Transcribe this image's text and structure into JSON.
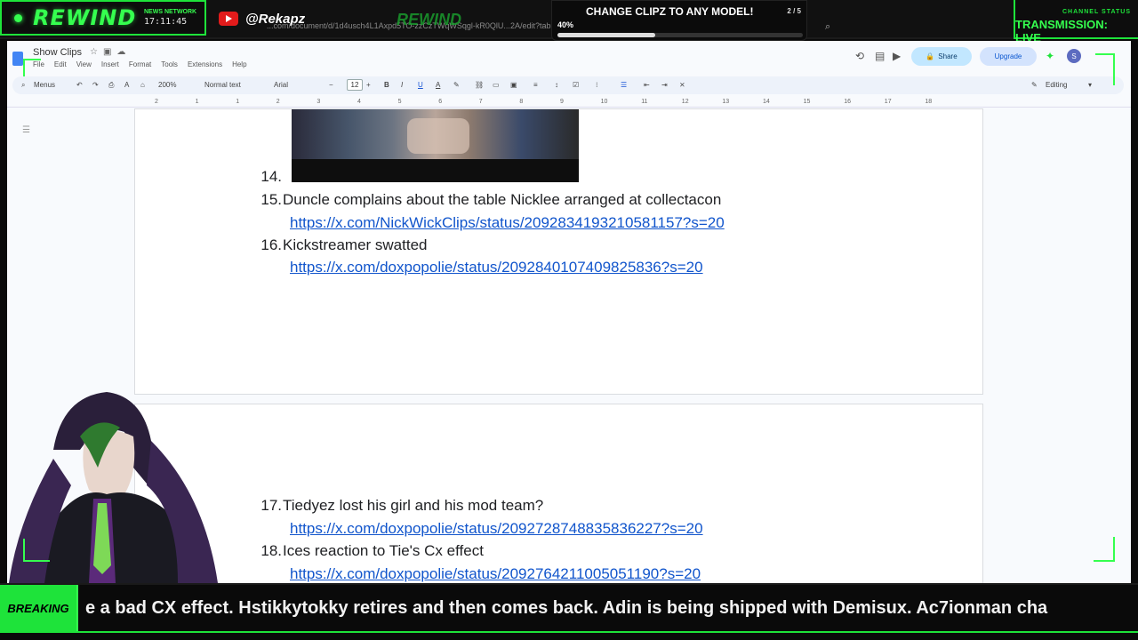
{
  "overlay": {
    "logo": "REWIND",
    "network_label": "NEWS NETWORK",
    "clock": "17:11:45",
    "handle": "@Rekapz",
    "url_fragment": "...com/document/d/1d4usch4L1Axpd5TO-zzCzTWqWSqgl-kR0QlU...2A/edit?tab=t.0",
    "ghost_logo": "REWIND",
    "promo_title": "CHANGE CLIPZ TO ANY MODEL!",
    "promo_count": "2 / 5",
    "promo_percent_label": "40%",
    "promo_progress": 0.4,
    "status_label": "CHANNEL STATUS",
    "status_value": "TRANSMISSION: LIVE",
    "accent": "#35ff4f"
  },
  "docs": {
    "title": "Show Clips",
    "menu": [
      "File",
      "Edit",
      "View",
      "Insert",
      "Format",
      "Tools",
      "Extensions",
      "Help"
    ],
    "share_label": "Share",
    "upgrade_label": "Upgrade",
    "avatar_letter": "S",
    "toolbar": {
      "menus_label": "Menus",
      "zoom": "200%",
      "style": "Normal text",
      "font": "Arial",
      "font_size": "12",
      "mode": "Editing"
    },
    "ruler": [
      "2",
      "1",
      "1",
      "2",
      "3",
      "4",
      "5",
      "6",
      "7",
      "8",
      "9",
      "10",
      "11",
      "12",
      "13",
      "14",
      "15",
      "16",
      "17",
      "18"
    ],
    "items": [
      {
        "num": "14.",
        "text": "",
        "link": ""
      },
      {
        "num": "15.",
        "text": "Duncle complains about the table Nicklee arranged at collectacon",
        "link": "https://x.com/NickWickClips/status/2092834193210581157?s=20"
      },
      {
        "num": "16.",
        "text": "Kickstreamer swatted",
        "link": "https://x.com/doxpopolie/status/2092840107409825836?s=20"
      },
      {
        "num": "17.",
        "text": "Tiedyez lost his girl and his mod team?",
        "link": "https://x.com/doxpopolie/status/2092728748835836227?s=20"
      },
      {
        "num": "18.",
        "text": "Ices reaction to Tie's Cx effect",
        "link": "https://x.com/doxpopolie/status/2092764211005051190?s=20"
      }
    ]
  },
  "ticker": {
    "label": "BREAKING",
    "text": "e a bad CX effect. Hstikkytokky retires and then comes back. Adin is being shipped with Demisux. Ac7ionman cha"
  }
}
